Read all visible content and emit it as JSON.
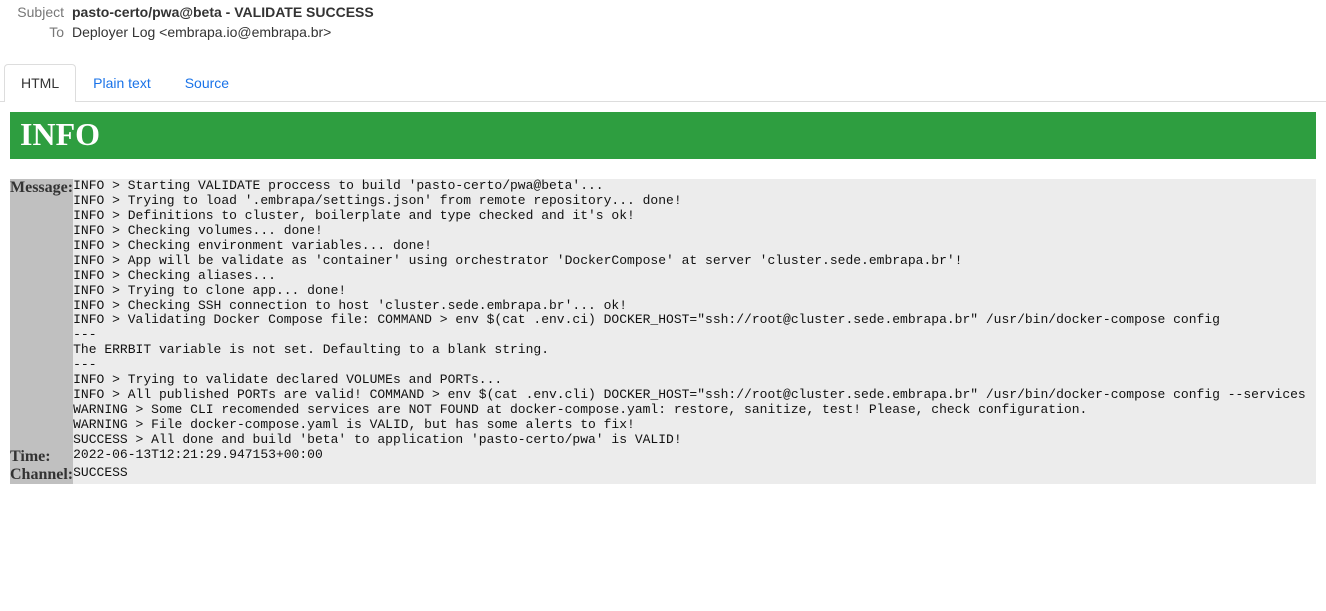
{
  "header": {
    "subject_label": "Subject",
    "subject_value": "pasto-certo/pwa@beta - VALIDATE SUCCESS",
    "to_label": "To",
    "to_value": "Deployer Log <embrapa.io@embrapa.br>"
  },
  "tabs": {
    "html": "HTML",
    "plain": "Plain text",
    "source": "Source"
  },
  "email": {
    "banner": "INFO",
    "message_label": "Message:",
    "message_value": "INFO > Starting VALIDATE proccess to build 'pasto-certo/pwa@beta'...\nINFO > Trying to load '.embrapa/settings.json' from remote repository... done!\nINFO > Definitions to cluster, boilerplate and type checked and it's ok!\nINFO > Checking volumes... done!\nINFO > Checking environment variables... done!\nINFO > App will be validate as 'container' using orchestrator 'DockerCompose' at server 'cluster.sede.embrapa.br'!\nINFO > Checking aliases...\nINFO > Trying to clone app... done!\nINFO > Checking SSH connection to host 'cluster.sede.embrapa.br'... ok!\nINFO > Validating Docker Compose file: COMMAND > env $(cat .env.ci) DOCKER_HOST=\"ssh://root@cluster.sede.embrapa.br\" /usr/bin/docker-compose config\n---\nThe ERRBIT variable is not set. Defaulting to a blank string.\n---\nINFO > Trying to validate declared VOLUMEs and PORTs...\nINFO > All published PORTs are valid! COMMAND > env $(cat .env.cli) DOCKER_HOST=\"ssh://root@cluster.sede.embrapa.br\" /usr/bin/docker-compose config --services\nWARNING > Some CLI recomended services are NOT FOUND at docker-compose.yaml: restore, sanitize, test! Please, check configuration.\nWARNING > File docker-compose.yaml is VALID, but has some alerts to fix!\nSUCCESS > All done and build 'beta' to application 'pasto-certo/pwa' is VALID!",
    "time_label": "Time:",
    "time_value": "2022-06-13T12:21:29.947153+00:00",
    "channel_label": "Channel:",
    "channel_value": "SUCCESS"
  }
}
